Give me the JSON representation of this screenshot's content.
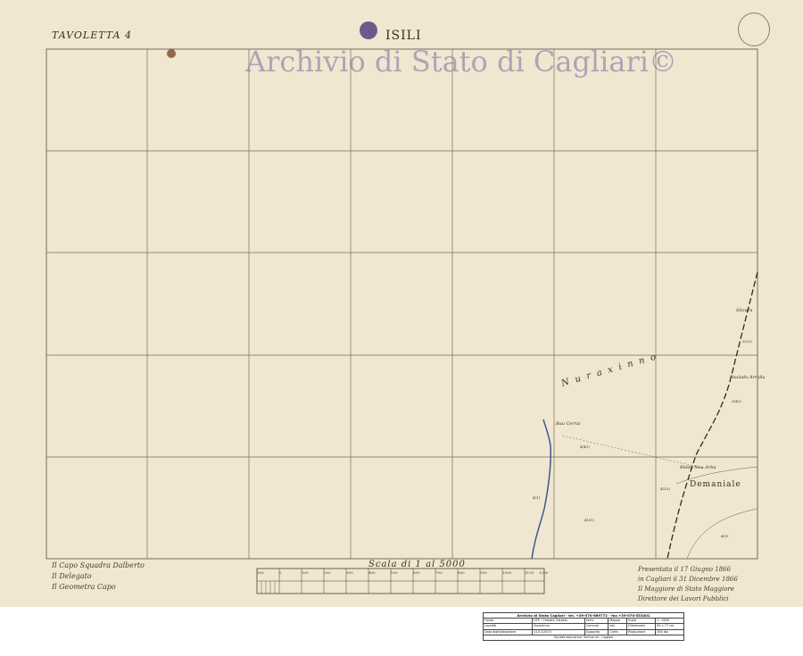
{
  "header": {
    "sheet_label": "TAVOLETTA 4",
    "place_title": "ISILI",
    "watermark": "Archivio di Stato di Cagliari©"
  },
  "map": {
    "region_name": "Nuraxinno",
    "domain_label": "Demaniale",
    "place_names": [
      "Sitzuru",
      "Bau Cerrai",
      "Pauladu Arrolia",
      "Bidda Noa Arbu"
    ],
    "parcel_numbers": [
      "3(35)",
      "3(43)",
      "4(43)",
      "4(33)",
      "4(35)",
      "4(1)",
      "4(5)"
    ],
    "colors": {
      "paper": "#f1e7d1",
      "grid": "#7a6a5a",
      "ink": "#3a2c20",
      "river": "#3c5a8a"
    }
  },
  "scale": {
    "title": "Scala di 1 al 5000",
    "tick_labels": [
      "100",
      "0",
      "100",
      "200",
      "300",
      "400",
      "500",
      "600",
      "700",
      "800",
      "900",
      "1000",
      "1100",
      "1200"
    ]
  },
  "signatures": {
    "left": [
      "Il Capo Squadra Dalberto",
      "Il Delegato",
      "Il Geometra Capo"
    ],
    "right": [
      "Presentata il 17 Giugno 1866",
      "in Cagliari il 31 Dicembre 1866",
      "Il Maggiore di Stato Maggiore",
      "Direttore dei Lavori Pubblici"
    ]
  },
  "info_table": {
    "header": "Archivio di Stato Cagliari - tel. +39-070-669772 - fax +39-070-553401",
    "rows": [
      [
        "Fondo",
        "UTE - Cessato Catasto",
        "Serie",
        "Mappe",
        "Scala",
        "1 : 5000"
      ],
      [
        "Località",
        "Nuraxinno",
        "Comune",
        "Isili",
        "Dimensioni",
        "62 x 77 cm"
      ],
      [
        "Data digitalizzazione",
        "11/11/2015",
        "Supporto",
        "Carta",
        "Risoluzione",
        "300 dpi"
      ]
    ],
    "footer": "Società esecutrice: Techne srl - Cagliari"
  }
}
